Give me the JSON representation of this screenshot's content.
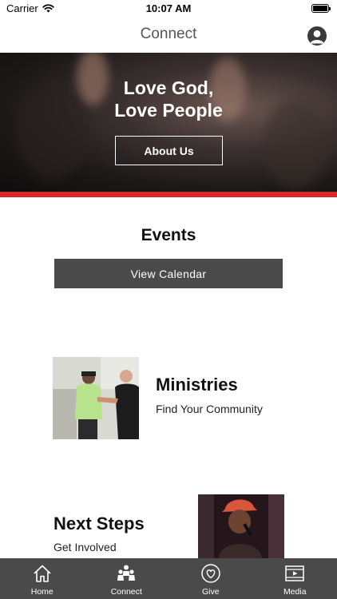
{
  "status_bar": {
    "carrier": "Carrier",
    "time": "10:07 AM"
  },
  "nav": {
    "title": "Connect",
    "profile_icon": "person-circle-icon"
  },
  "hero": {
    "title": "Love God,\nLove People",
    "button_label": "About Us",
    "accent_color": "#d9272b"
  },
  "events": {
    "title": "Events",
    "button_label": "View Calendar"
  },
  "ministries": {
    "title": "Ministries",
    "subtitle": "Find Your Community"
  },
  "next_steps": {
    "title": "Next Steps",
    "subtitle": "Get Involved"
  },
  "tab_bar": {
    "background": "#4a4a4a",
    "tabs": [
      {
        "label": "Home",
        "icon": "home-icon"
      },
      {
        "label": "Connect",
        "icon": "people-icon"
      },
      {
        "label": "Give",
        "icon": "heart-circle-icon"
      },
      {
        "label": "Media",
        "icon": "play-media-icon"
      }
    ]
  }
}
